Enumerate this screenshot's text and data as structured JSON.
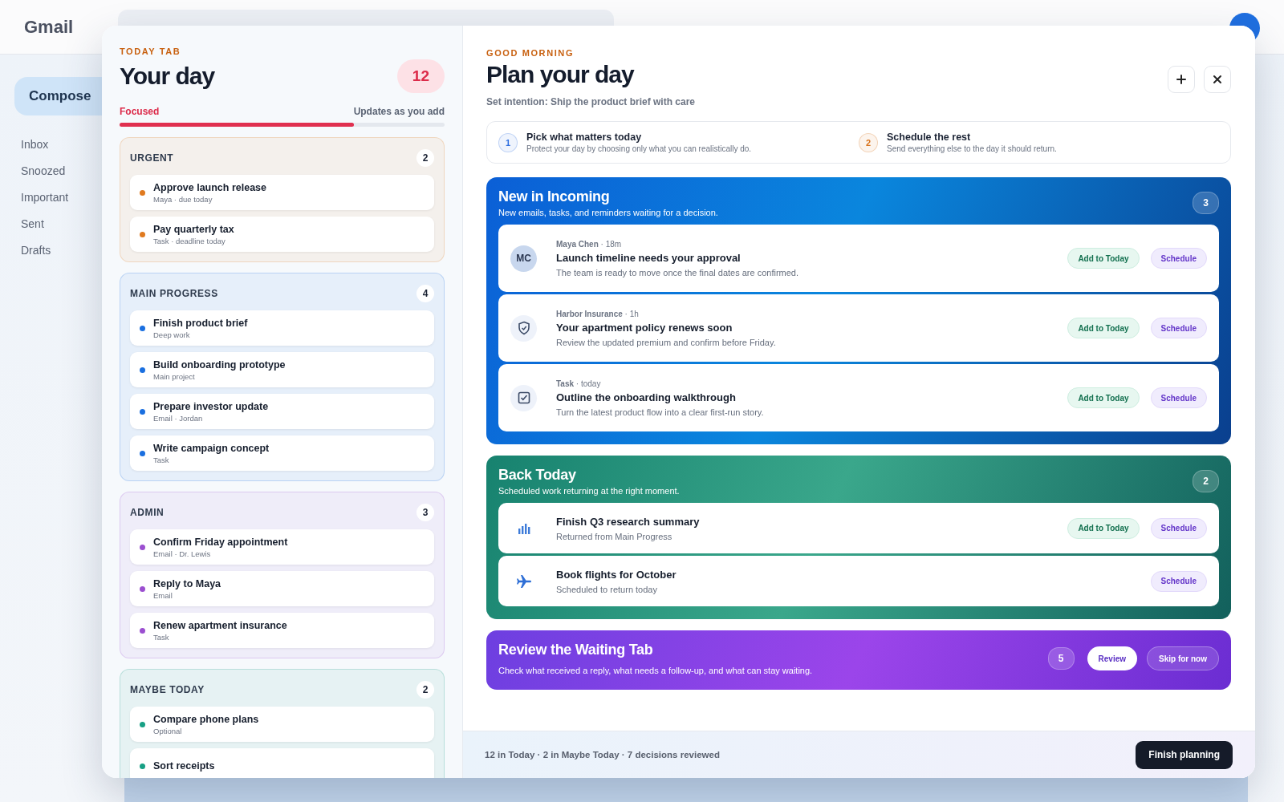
{
  "app": {
    "logo": "Gmail",
    "compose": "Compose",
    "nav": [
      "Inbox",
      "Snoozed",
      "Important",
      "Sent",
      "Drafts"
    ]
  },
  "today": {
    "eyebrow": "TODAY TAB",
    "title": "Your day",
    "count": "12",
    "progress_label": "Focused",
    "progress_note": "Updates as you add",
    "level": 0.72,
    "groups": [
      {
        "title": "URGENT",
        "count": "2",
        "color": "#e07a1f",
        "items": [
          {
            "title": "Approve launch release",
            "meta": "Maya · due today"
          },
          {
            "title": "Pay quarterly tax",
            "meta": "Task · deadline today"
          }
        ]
      },
      {
        "title": "MAIN PROGRESS",
        "count": "4",
        "color": "#1a6fe0",
        "items": [
          {
            "title": "Finish product brief",
            "meta": "Deep work"
          },
          {
            "title": "Build onboarding prototype",
            "meta": "Main project"
          },
          {
            "title": "Prepare investor update",
            "meta": "Email · Jordan"
          },
          {
            "title": "Write campaign concept",
            "meta": "Task"
          }
        ]
      },
      {
        "title": "ADMIN",
        "count": "3",
        "color": "#9b4fd0",
        "items": [
          {
            "title": "Confirm Friday appointment",
            "meta": "Email · Dr. Lewis"
          },
          {
            "title": "Reply to Maya",
            "meta": "Email"
          },
          {
            "title": "Renew apartment insurance",
            "meta": "Task"
          }
        ]
      },
      {
        "title": "MAYBE TODAY",
        "count": "2",
        "color": "#18a085",
        "items": [
          {
            "title": "Compare phone plans",
            "meta": "Optional"
          },
          {
            "title": "Sort receipts"
          }
        ]
      }
    ]
  },
  "plan": {
    "eyebrow": "GOOD MORNING",
    "title": "Plan your day",
    "intention": "Set intention: Ship the product brief with care",
    "steps": [
      {
        "number": "1",
        "title": "Pick what matters today",
        "text": "Protect your day by choosing only what you can realistically do.",
        "color": "#2f6fe0"
      },
      {
        "number": "2",
        "title": "Schedule the rest",
        "text": "Send everything else to the day it should return.",
        "color": "#d9731c"
      }
    ],
    "sections": [
      {
        "kind": "incoming",
        "title": "New in Incoming",
        "subtitle": "New emails, tasks, and reminders waiting for a decision.",
        "count": "3",
        "items": [
          {
            "avatar": {
              "kind": "initials",
              "text": "MC"
            },
            "meta": "**Maya Chen** · 18m",
            "title": "Launch timeline needs your approval",
            "text": "The team is ready to move once the final dates are confirmed.",
            "actions": [
              {
                "kind": "add",
                "label": "Add to Today"
              },
              {
                "kind": "schedule",
                "label": "Schedule"
              }
            ]
          },
          {
            "avatar": {
              "kind": "shield"
            },
            "meta": "**Harbor Insurance** · 1h",
            "title": "Your apartment policy renews soon",
            "text": "Review the updated premium and confirm before Friday.",
            "actions": [
              {
                "kind": "add",
                "label": "Add to Today"
              },
              {
                "kind": "schedule",
                "label": "Schedule"
              }
            ]
          },
          {
            "avatar": {
              "kind": "check"
            },
            "meta": "**Task** · today",
            "title": "Outline the onboarding walkthrough",
            "text": "Turn the latest product flow into a clear first-run story.",
            "actions": [
              {
                "kind": "add",
                "label": "Add to Today"
              },
              {
                "kind": "schedule",
                "label": "Schedule"
              }
            ]
          }
        ]
      },
      {
        "kind": "back",
        "title": "Back Today",
        "subtitle": "Scheduled work returning at the right moment.",
        "count": "2",
        "items": [
          {
            "avatar": {
              "kind": "chart"
            },
            "title": "Finish Q3 research summary",
            "text": "Returned from Main Progress",
            "actions": [
              {
                "kind": "add",
                "label": "Add to Today"
              },
              {
                "kind": "schedule",
                "label": "Schedule"
              }
            ]
          },
          {
            "avatar": {
              "kind": "plane"
            },
            "title": "Book flights for October",
            "text": "Scheduled to return today",
            "actions": [
              {
                "kind": "schedule",
                "label": "Schedule"
              }
            ]
          }
        ]
      },
      {
        "kind": "waiting",
        "title": "Review the Waiting Tab",
        "subtitle": "Check what received a reply, what needs a follow-up, and what can stay waiting.",
        "count": "5",
        "actions": [
          {
            "kind": "primary",
            "label": "Review"
          },
          {
            "kind": "ghost",
            "label": "Skip for now"
          }
        ]
      }
    ]
  },
  "footer": {
    "summary": "12 in Today · 2 in Maybe Today · 7 decisions reviewed",
    "button": "Finish planning"
  }
}
